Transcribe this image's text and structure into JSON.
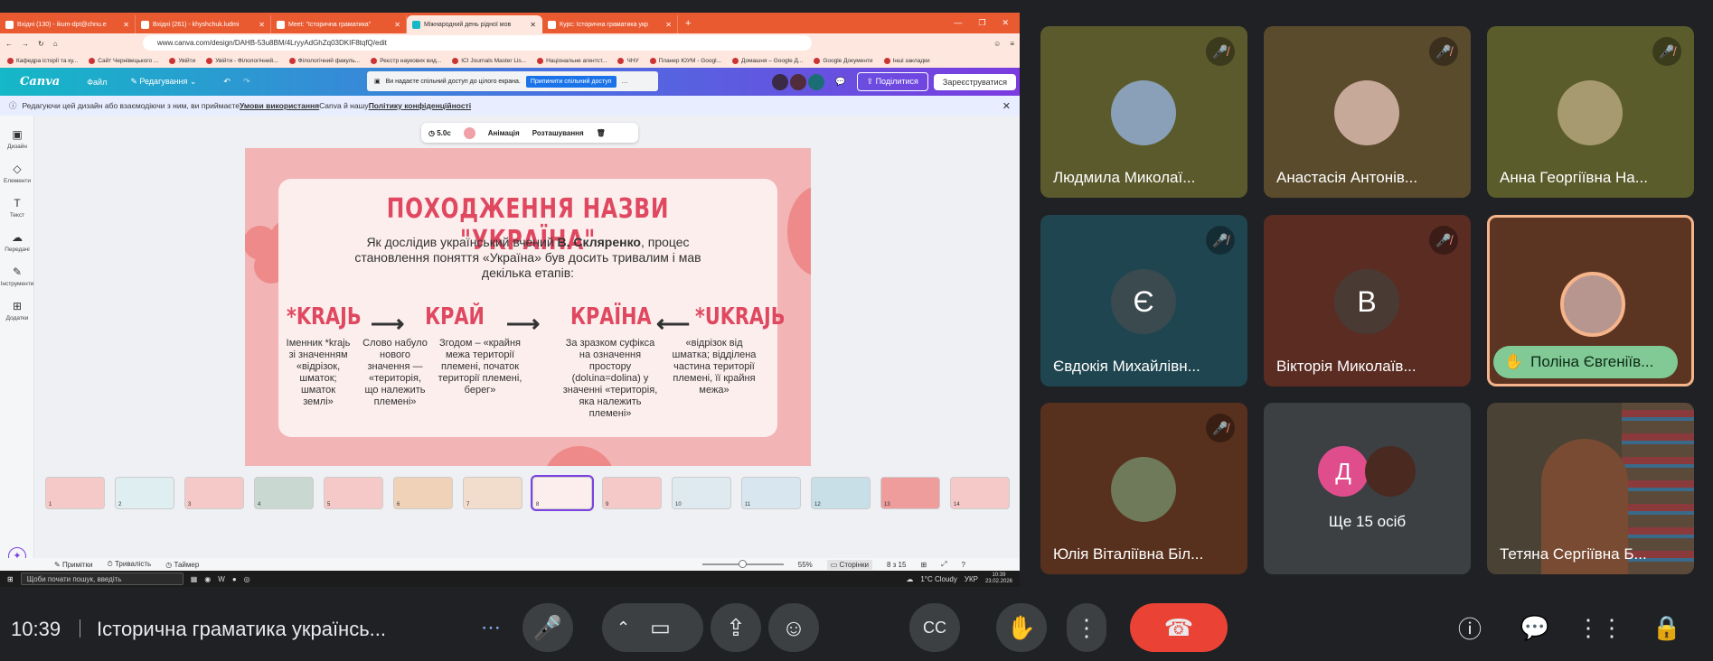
{
  "browser": {
    "tabs": [
      {
        "label": "Вхідні (130) - ikum-dpt@chnu.e"
      },
      {
        "label": "Вхідні (261) - khyshchuk.ludmi"
      },
      {
        "label": "Meet: \"Історична граматика\""
      },
      {
        "label": "Міжнародний день рідної мов",
        "active": true
      },
      {
        "label": "Курс: Історична граматика укр"
      }
    ],
    "url": "www.canva.com/design/DAHB-53u8BM/4LryyAdGhZq03DKIF8tqfQ/edit",
    "bookmarks": [
      "Кафедра історії та ку...",
      "Сайт Чернівецького ...",
      "Увійти",
      "Увійти - Філологічний...",
      "Філологічний факуль...",
      "Реєстр наукових вид...",
      "ICI Journals Master Lis...",
      "Національне агентст...",
      "ЧНУ",
      "Планер ЮУМ - Googl...",
      "Домашня – Google Д...",
      "Google Документи",
      "Інші закладки"
    ]
  },
  "canva": {
    "menu": [
      "Файл",
      "Редагування"
    ],
    "share_banner": "Ви надаєте спільний доступ до цілого екрана.",
    "share_button": "Припинити спільний доступ",
    "share_label": "Поділитися",
    "register_label": "Зареєструватися",
    "notice": {
      "before": "Редагуючи цей дизайн або взаємодіючи з ним, ви приймаєте ",
      "link1": "Умови використання",
      "middle": " Canva й нашу ",
      "link2": "Політику конфіденційності"
    },
    "sidebar": [
      "Дизайн",
      "Елементи",
      "Текст",
      "Передачі",
      "Інструменти",
      "Додатки"
    ],
    "element_toolbar": {
      "duration": "5.0с",
      "animation": "Анімація",
      "position": "Розташування"
    },
    "slide": {
      "title": "ПОХОДЖЕННЯ НАЗВИ \"УКРАЇНА\"",
      "intro_prefix": "Як дослідив український вчений ",
      "scientist": "В. Скляренко",
      "intro_rest": ", процес становлення поняття «Україна» був досить тривалим і мав декілька етапів:",
      "stages": [
        {
          "word": "*KRAJЬ",
          "desc": "Іменник *krajь зі значенням «відрізок, шматок; шматок землі»"
        },
        {
          "word": "КРАЙ",
          "desc": "Слово набуло нового значення — «територія, що належить племені»"
        },
        {
          "word": "КРАЇНА",
          "desc": "Згодом – «крайня межа території племені, початок території племені, берег»"
        },
        {
          "word": "*UKRAJЬ",
          "desc": "«відрізок від шматка; відділена частина території племені, її крайня межа»"
        }
      ],
      "stage_extra": "За зразком суфікса на означення простору (dolꙇina=dolina) у значенні «територія, яка належить племені»"
    },
    "thumbnail_count": 14,
    "selected_thumbnail": 8,
    "bottom": {
      "notes": "Примітки",
      "duration": "Тривалість",
      "timer": "Таймер",
      "zoom": "55%",
      "pages": "Сторінки",
      "page_count": "8 з 15"
    }
  },
  "taskbar": {
    "search": "Щоби почати пошук, введіть",
    "weather": "1°C Cloudy",
    "lang": "УКР",
    "time": "10:39",
    "date": "23.02.2026"
  },
  "participants": [
    {
      "name": "Людмила Миколаї...",
      "muted": true,
      "bg": "#5b5a2c"
    },
    {
      "name": "Анастасія Антонів...",
      "muted": true,
      "bg": "#5a4b2d"
    },
    {
      "name": "Анна Георгіївна На...",
      "muted": true,
      "bg": "#5a5c2b"
    },
    {
      "name": "Євдокія Михайлівн...",
      "initial": "Є",
      "muted": true,
      "bg": "#1f4650"
    },
    {
      "name": "Вікторія Миколаїв...",
      "initial": "В",
      "muted": true,
      "bg": "#5b2c22"
    },
    {
      "name": "Поліна Євгеніїв...",
      "muted": false,
      "bg": "#5b3422",
      "hand": true
    },
    {
      "name": "Юлія Віталіївна Біл...",
      "muted": true,
      "bg": "#58311e"
    },
    {
      "name": "Ще 15 осіб",
      "initial": "Д",
      "muted": false,
      "bg": "#3c4043"
    },
    {
      "name": "Тетяна Сергіївна Б...",
      "muted": false,
      "bg": "#4a4235"
    }
  ],
  "meet": {
    "time": "10:39",
    "title": "Історична граматика українсь..."
  }
}
